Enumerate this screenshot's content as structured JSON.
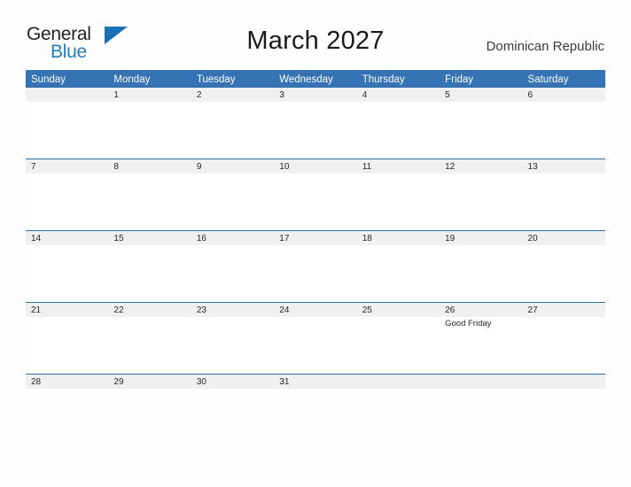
{
  "brand": {
    "name_part1": "General",
    "name_part2": "Blue",
    "triangle_icon": "triangle-icon",
    "colors": {
      "dark_text": "#231f20",
      "blue_text": "#1f7fc4",
      "triangle": "#1a6fb5"
    }
  },
  "header": {
    "title": "March 2027",
    "country": "Dominican Republic"
  },
  "colors": {
    "header_blue": "#3573b4",
    "row_line_blue": "#2e6da4",
    "date_band_gray": "#f0f0f0",
    "page_background": "#fdfdfd",
    "text": "#262626"
  },
  "calendar": {
    "day_names": [
      "Sunday",
      "Monday",
      "Tuesday",
      "Wednesday",
      "Thursday",
      "Friday",
      "Saturday"
    ],
    "weeks": [
      {
        "days": [
          {
            "date": "",
            "events": []
          },
          {
            "date": "1",
            "events": []
          },
          {
            "date": "2",
            "events": []
          },
          {
            "date": "3",
            "events": []
          },
          {
            "date": "4",
            "events": []
          },
          {
            "date": "5",
            "events": []
          },
          {
            "date": "6",
            "events": []
          }
        ]
      },
      {
        "days": [
          {
            "date": "7",
            "events": []
          },
          {
            "date": "8",
            "events": []
          },
          {
            "date": "9",
            "events": []
          },
          {
            "date": "10",
            "events": []
          },
          {
            "date": "11",
            "events": []
          },
          {
            "date": "12",
            "events": []
          },
          {
            "date": "13",
            "events": []
          }
        ]
      },
      {
        "days": [
          {
            "date": "14",
            "events": []
          },
          {
            "date": "15",
            "events": []
          },
          {
            "date": "16",
            "events": []
          },
          {
            "date": "17",
            "events": []
          },
          {
            "date": "18",
            "events": []
          },
          {
            "date": "19",
            "events": []
          },
          {
            "date": "20",
            "events": []
          }
        ]
      },
      {
        "days": [
          {
            "date": "21",
            "events": []
          },
          {
            "date": "22",
            "events": []
          },
          {
            "date": "23",
            "events": []
          },
          {
            "date": "24",
            "events": []
          },
          {
            "date": "25",
            "events": []
          },
          {
            "date": "26",
            "events": [
              "Good Friday"
            ]
          },
          {
            "date": "27",
            "events": []
          }
        ]
      },
      {
        "days": [
          {
            "date": "28",
            "events": []
          },
          {
            "date": "29",
            "events": []
          },
          {
            "date": "30",
            "events": []
          },
          {
            "date": "31",
            "events": []
          },
          {
            "date": "",
            "events": []
          },
          {
            "date": "",
            "events": []
          },
          {
            "date": "",
            "events": []
          }
        ]
      }
    ]
  }
}
